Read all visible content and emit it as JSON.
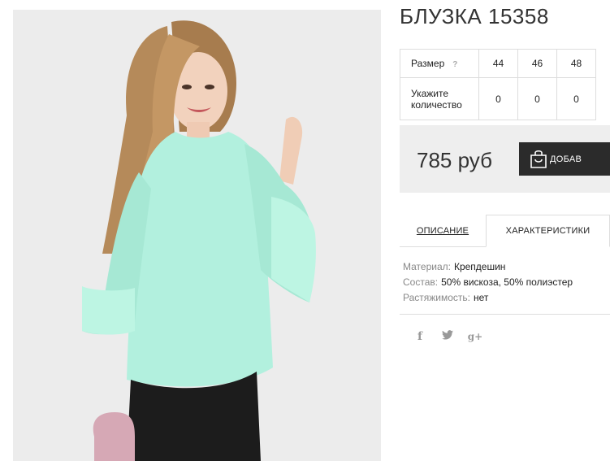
{
  "product": {
    "title": "БЛУЗКА 15358"
  },
  "size_table": {
    "size_label": "Размер",
    "help_icon": "?",
    "qty_label": "Укажите количество",
    "sizes": [
      "44",
      "46",
      "48"
    ],
    "quantities": [
      "0",
      "0",
      "0"
    ]
  },
  "price": {
    "value": "785 руб",
    "add_to_cart_label": "ДОБАВ"
  },
  "tabs": {
    "description": "ОПИСАНИЕ",
    "characteristics": "ХАРАКТЕРИСТИКИ"
  },
  "characteristics": [
    {
      "key": "Материал:",
      "value": "Крепдешин"
    },
    {
      "key": "Состав:",
      "value": "50% вискоза, 50% полиэстер"
    },
    {
      "key": "Растяжимость:",
      "value": "нет"
    }
  ],
  "social": {
    "facebook": "f",
    "twitter": "t",
    "googleplus": "g+"
  },
  "colors": {
    "accent_dark": "#2b2b2b",
    "price_bg": "#eeeeee",
    "blouse_mint": "#aef0dc"
  }
}
